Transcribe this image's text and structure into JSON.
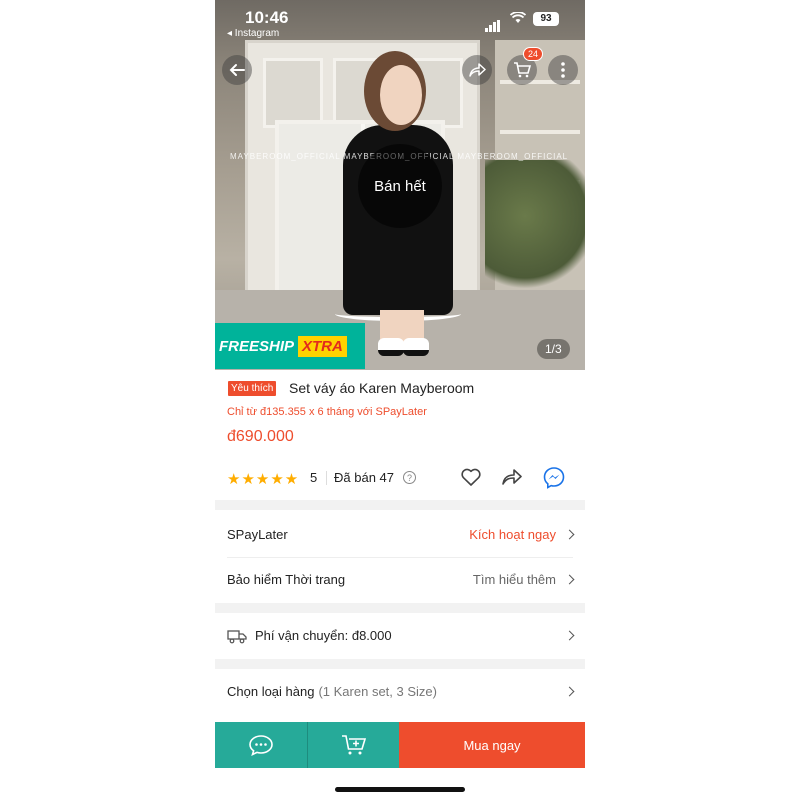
{
  "status_bar": {
    "time": "10:46",
    "back_app": "◂ Instagram",
    "battery": "93"
  },
  "hero": {
    "watermark": "MAYBEROOM_OFFICIAL  MAYBEROOM_OFFICIAL  MAYBEROOM_OFFICIAL",
    "cart_count": "24",
    "sold_out": "Bán hết",
    "freeship_label": "FREESHIP",
    "freeship_xtra": "XTRA",
    "image_counter": "1/3"
  },
  "product": {
    "tag": "Yêu thích",
    "name": "Set váy áo Karen Mayberoom",
    "spaylater_offer": "Chỉ từ đ135.355 x 6 tháng với SPayLater",
    "price": "đ690.000",
    "stars": "★★★★★",
    "rating": "5",
    "sold": "Đã bán 47"
  },
  "rows": {
    "spaylater": {
      "label": "SPayLater",
      "action": "Kích hoạt ngay"
    },
    "insurance": {
      "label": "Bảo hiểm Thời trang",
      "action": "Tìm hiểu thêm"
    },
    "shipping": {
      "label": "Phí vận chuyển: đ8.000"
    },
    "variant": {
      "label": "Chọn loại hàng",
      "detail": "(1 Karen set, 3 Size)"
    }
  },
  "bottom_bar": {
    "buy_label": "Mua ngay"
  },
  "colors": {
    "accent": "#ee4d2d",
    "teal": "#26aa99",
    "star": "#ffad00"
  }
}
